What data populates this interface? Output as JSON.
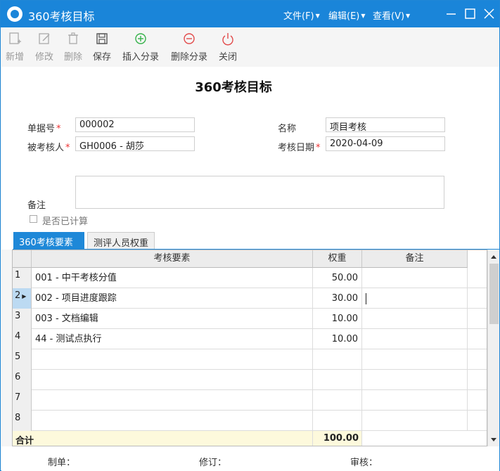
{
  "window": {
    "title": "360考核目标",
    "menus": [
      "文件(F)",
      "编辑(E)",
      "查看(V)"
    ]
  },
  "toolbar": {
    "new": "新增",
    "edit": "修改",
    "delete": "删除",
    "save": "保存",
    "insert_entry": "插入分录",
    "delete_entry": "删除分录",
    "close": "关闭"
  },
  "form": {
    "doc_title": "360考核目标",
    "doc_no_label": "单据号",
    "doc_no": "000002",
    "name_label": "名称",
    "name": "项目考核",
    "assessee_label": "被考核人",
    "assessee": "GH0006 - 胡莎",
    "date_label": "考核日期",
    "date": "2020-04-09",
    "remark_label": "备注",
    "calculated_label": "是否已计算"
  },
  "tabs": [
    "360考核要素",
    "测评人员权重"
  ],
  "grid": {
    "columns": [
      "考核要素",
      "权重",
      "备注"
    ],
    "rows": [
      {
        "no": "1",
        "element": "001 - 中干考核分值",
        "weight": "50.00",
        "remark": ""
      },
      {
        "no": "2",
        "element": "002 - 项目进度跟踪",
        "weight": "30.00",
        "remark": ""
      },
      {
        "no": "3",
        "element": "003 - 文档编辑",
        "weight": "10.00",
        "remark": ""
      },
      {
        "no": "4",
        "element": "44 - 测试点执行",
        "weight": "10.00",
        "remark": ""
      },
      {
        "no": "5",
        "element": "",
        "weight": "",
        "remark": ""
      },
      {
        "no": "6",
        "element": "",
        "weight": "",
        "remark": ""
      },
      {
        "no": "7",
        "element": "",
        "weight": "",
        "remark": ""
      },
      {
        "no": "8",
        "element": "",
        "weight": "",
        "remark": ""
      }
    ],
    "total_label": "合计",
    "total_weight": "100.00"
  },
  "footer": {
    "maker": "制单：",
    "reviser": "修订：",
    "auditor": "审核："
  },
  "colors": {
    "accent": "#1a85d9",
    "required": "#e33333",
    "total_bg": "#fdf9dc"
  }
}
